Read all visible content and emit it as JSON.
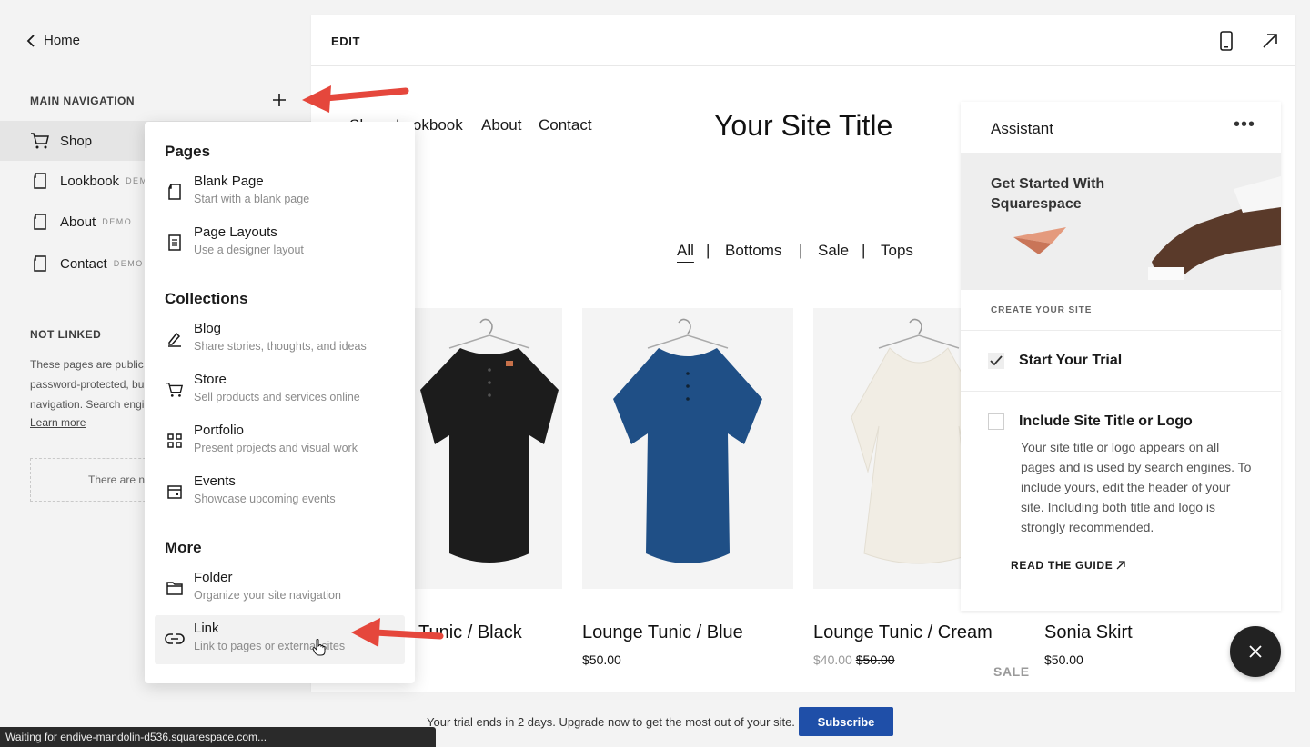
{
  "sidebar": {
    "home_label": "Home",
    "main_nav_title": "MAIN NAVIGATION",
    "items": [
      {
        "label": "Shop",
        "badge": ""
      },
      {
        "label": "Lookbook",
        "badge": "DEMO"
      },
      {
        "label": "About",
        "badge": "DEMO"
      },
      {
        "label": "Contact",
        "badge": "DEMO"
      }
    ],
    "not_linked_title": "NOT LINKED",
    "not_linked_lines": [
      "These pages are public u",
      "password-protected, bu",
      "navigation. Search engin"
    ],
    "learn_more": "Learn more",
    "empty_text": "There are no"
  },
  "editor": {
    "edit_label": "EDIT",
    "site_nav": [
      "Shop",
      "Lookbook",
      "About",
      "Contact"
    ],
    "site_title": "Your Site Title",
    "filters": [
      "All",
      "Bottoms",
      "Sale",
      "Tops"
    ],
    "filter_sep": "|",
    "products": [
      {
        "name": "Tunic / Black",
        "price": "",
        "sale_price": "",
        "old_price": "",
        "color": "#1c1c1c"
      },
      {
        "name": "Lounge Tunic / Blue",
        "price": "$50.00",
        "sale_price": "",
        "old_price": "",
        "color": "#1f4f86"
      },
      {
        "name": "Lounge Tunic / Cream",
        "price": "",
        "sale_price": "$40.00",
        "old_price": "$50.00",
        "color": "#f1ede4"
      },
      {
        "name": "Sonia Skirt",
        "price": "$50.00",
        "sale_price": "",
        "old_price": "",
        "color": ""
      }
    ],
    "sale_tag": "SALE"
  },
  "assistant": {
    "title": "Assistant",
    "menu_glyph": "•••",
    "hero_title": "Get Started With Squarespace",
    "section_label": "CREATE YOUR SITE",
    "tasks": [
      {
        "label": "Start Your Trial",
        "checked": true
      },
      {
        "label": "Include Site Title or Logo",
        "checked": false
      }
    ],
    "task_description": "Your site title or logo appears on all pages and is used by search engines. To include yours, edit the header of your site. Including both title and logo is strongly recommended.",
    "guide_link": "READ THE GUIDE"
  },
  "add_menu": {
    "sections": [
      {
        "title": "Pages",
        "items": [
          {
            "title": "Blank Page",
            "desc": "Start with a blank page",
            "icon": "blank-page-icon"
          },
          {
            "title": "Page Layouts",
            "desc": "Use a designer layout",
            "icon": "page-layouts-icon"
          }
        ]
      },
      {
        "title": "Collections",
        "items": [
          {
            "title": "Blog",
            "desc": "Share stories, thoughts, and ideas",
            "icon": "blog-icon"
          },
          {
            "title": "Store",
            "desc": "Sell products and services online",
            "icon": "store-icon"
          },
          {
            "title": "Portfolio",
            "desc": "Present projects and visual work",
            "icon": "portfolio-icon"
          },
          {
            "title": "Events",
            "desc": "Showcase upcoming events",
            "icon": "events-icon"
          }
        ]
      },
      {
        "title": "More",
        "items": [
          {
            "title": "Folder",
            "desc": "Organize your site navigation",
            "icon": "folder-icon"
          },
          {
            "title": "Link",
            "desc": "Link to pages or external sites",
            "icon": "link-icon"
          }
        ]
      }
    ]
  },
  "trial_bar": {
    "text": "Your trial ends in 2 days. Upgrade now to get the most out of your site.",
    "subscribe": "Subscribe"
  },
  "status_bar": "Waiting for endive-mandolin-d536.squarespace.com...",
  "colors": {
    "accent_blue": "#1f4fa8",
    "annotation_arrow": "#e5473c",
    "sidebar_bg": "#f3f3f3"
  }
}
